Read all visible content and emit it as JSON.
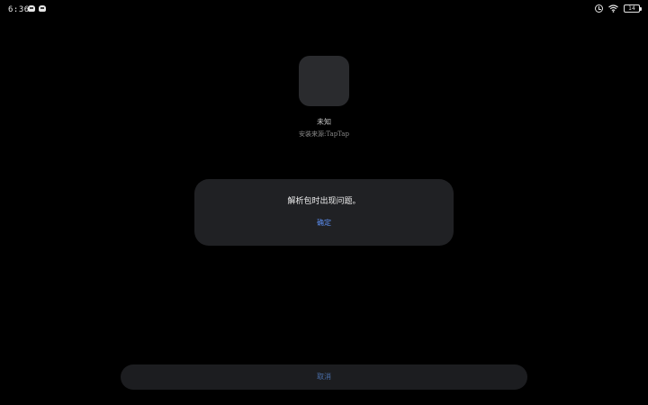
{
  "status_bar": {
    "time": "6:36",
    "battery_level": "14",
    "left_icons": [
      "app-notification-icon",
      "app-notification-icon"
    ],
    "right_icons": [
      "alarm-icon",
      "wifi-icon",
      "battery-icon"
    ]
  },
  "app": {
    "name": "未知",
    "source": "安装来源:TapTap"
  },
  "dialog": {
    "message": "解析包时出现问题。",
    "confirm_label": "确定"
  },
  "bottom": {
    "button_label": "取消"
  },
  "colors": {
    "background": "#000000",
    "dialog_bg": "#202124",
    "accent": "#5b8def",
    "bottom_button_bg": "#1c1d20"
  }
}
